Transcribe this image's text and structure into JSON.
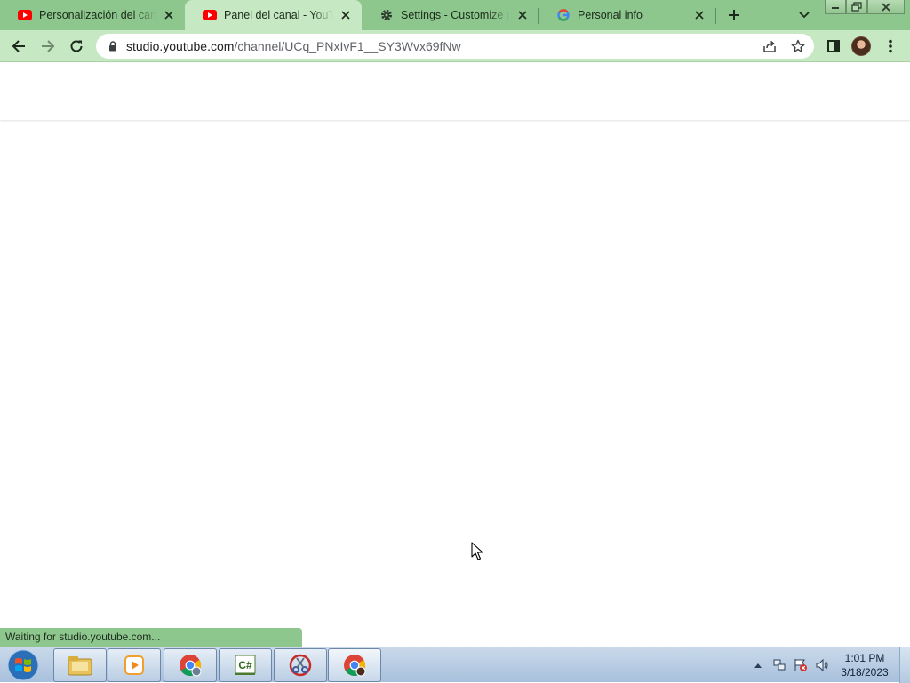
{
  "browser": {
    "tabs": [
      {
        "title": "Personalización del canal",
        "favicon": "youtube-icon",
        "active": false
      },
      {
        "title": "Panel del canal - YouTube Studio",
        "favicon": "youtube-icon",
        "active": true
      },
      {
        "title": "Settings - Customize profile",
        "favicon": "gear-icon",
        "active": false
      },
      {
        "title": "Personal info",
        "favicon": "google-icon",
        "active": false
      }
    ],
    "address_bar": {
      "domain": "studio.youtube.com",
      "path": "/channel/UCq_PNxIvF1__SY3Wvx69fNw"
    },
    "status_text": "Waiting for studio.youtube.com..."
  },
  "taskbar": {
    "clock_time": "1:01 PM",
    "clock_date": "3/18/2023",
    "apps": [
      "file-explorer-icon",
      "media-player-icon",
      "chrome-icon",
      "csharp-editor-icon",
      "snipping-tool-icon",
      "chrome-profile-icon"
    ]
  },
  "colors": {
    "tabstrip": "#8dc78d",
    "toolbar": "#c6e8c2",
    "youtube_red": "#ff0000",
    "taskbar": "#b9cde3"
  }
}
